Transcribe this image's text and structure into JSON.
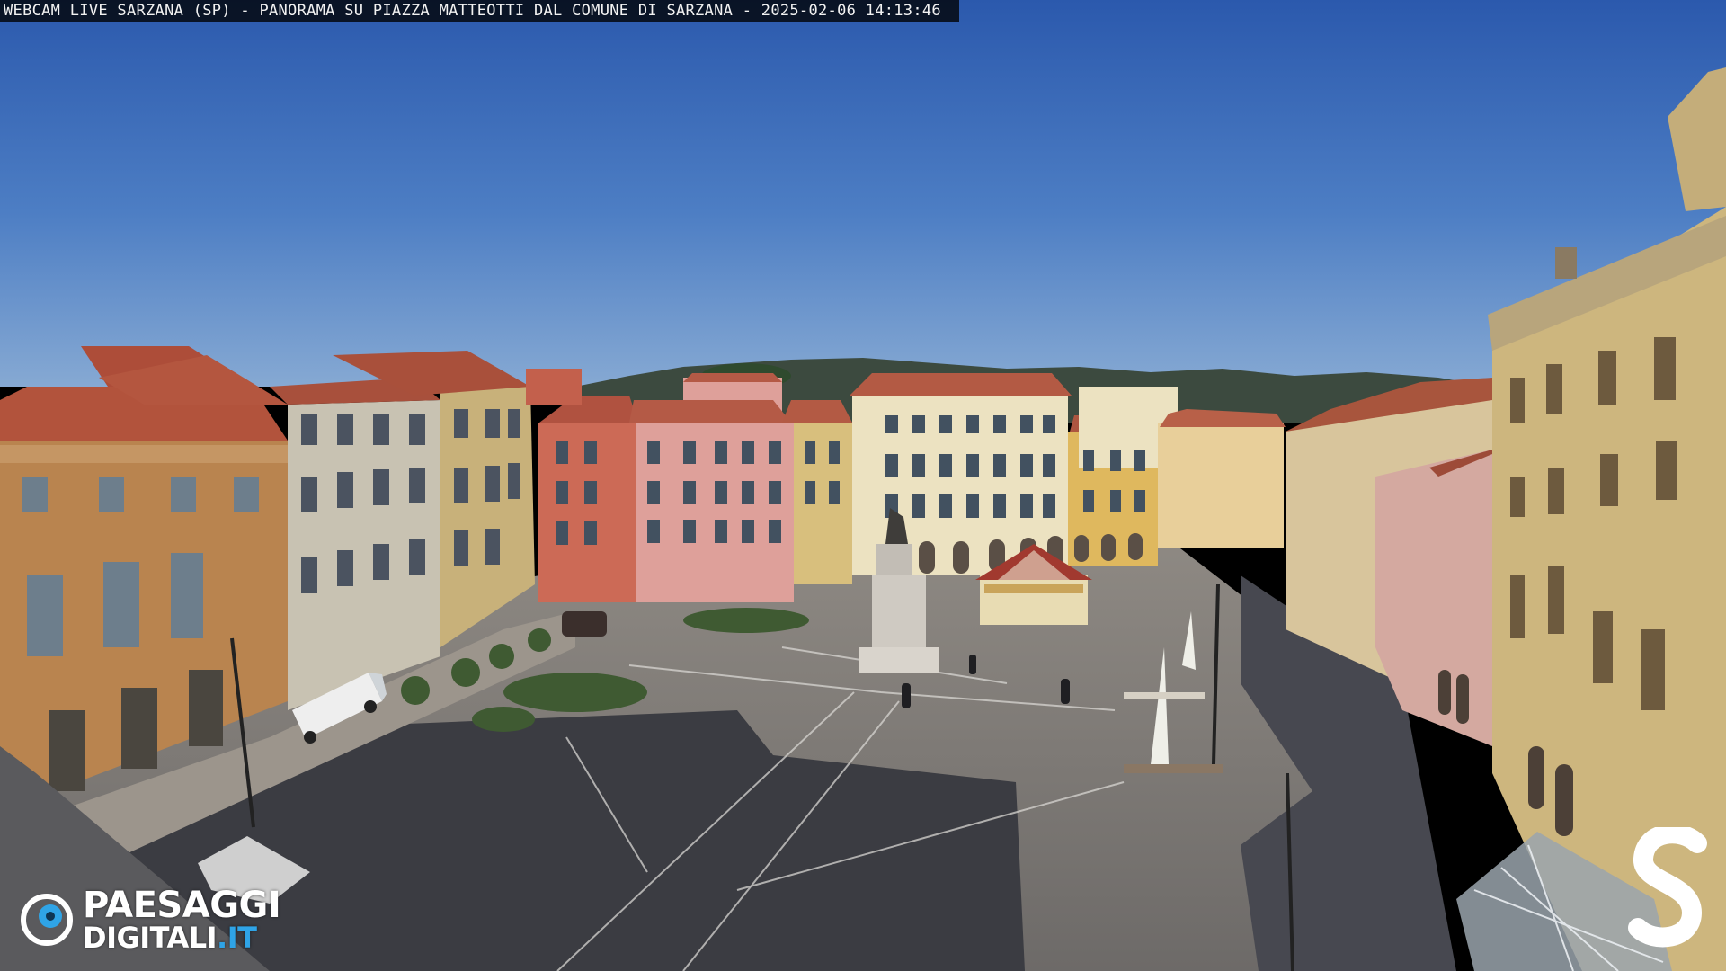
{
  "overlay": {
    "title": "WEBCAM LIVE SARZANA (SP) - PANORAMA SU PIAZZA MATTEOTTI DAL COMUNE DI SARZANA - 2025-02-06  14:13:46"
  },
  "branding": {
    "line1": "PAESAGGI",
    "line2_main": "DIGITALI",
    "line2_suffix": ".IT",
    "logo_icon": "eye-icon",
    "right_logo_icon": "s-logo-icon",
    "accent": "#2fa4e7"
  },
  "colors": {
    "sky_top": "#2f5fb0",
    "sky_bottom": "#79a2d4",
    "pavement": "#7a7775",
    "shadow": "#3a3b40"
  }
}
